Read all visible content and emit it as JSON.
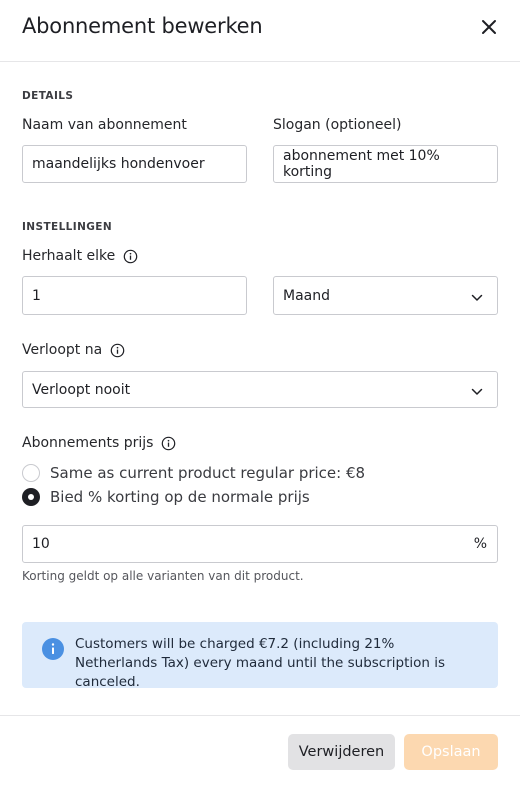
{
  "header": {
    "title": "Abonnement bewerken"
  },
  "details": {
    "section_label": "DETAILS",
    "name_label": "Naam van abonnement",
    "name_value": "maandelijks hondenvoer",
    "slogan_label": "Slogan (optioneel)",
    "slogan_value": "abonnement met 10% korting"
  },
  "settings": {
    "section_label": "INSTELLINGEN",
    "repeat_label": "Herhaalt elke",
    "repeat_value": "1",
    "repeat_unit": "Maand",
    "expires_label": "Verloopt na",
    "expires_value": "Verloopt nooit"
  },
  "price": {
    "label": "Abonnements prijs",
    "options": [
      {
        "label": "Same as current product regular price: €8",
        "checked": false
      },
      {
        "label": "Bied % korting op de normale prijs",
        "checked": true
      }
    ],
    "discount_value": "10",
    "discount_suffix": "%",
    "help_text": "Korting geldt op alle varianten van dit product."
  },
  "banner": {
    "text": "Customers will be charged €7.2 (including 21% Netherlands Tax) every maand until the subscription is canceled.",
    "color": "#dceafb"
  },
  "footer": {
    "delete_label": "Verwijderen",
    "save_label": "Opslaan",
    "save_color": "#fcd8b0"
  }
}
